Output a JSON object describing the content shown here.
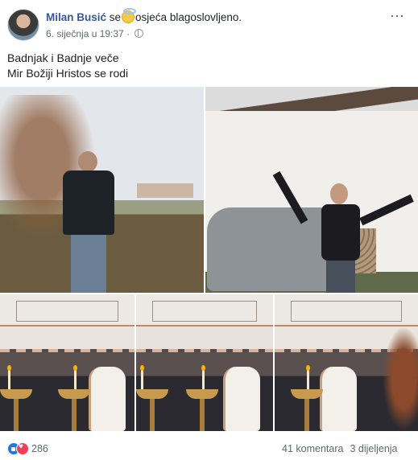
{
  "post": {
    "author": "Milan Busić",
    "feeling_prefix": "se",
    "feeling_text": "osjeća blagoslovljeno.",
    "timestamp": "6. siječnja u 19:37",
    "more_icon": "⋯",
    "text_lines": [
      "Badnjak i Badnje veče",
      "Mir Božiji Hristos se rodi"
    ]
  },
  "photos": [
    {
      "name": "photo-man-with-oak-branches"
    },
    {
      "name": "photo-man-raising-pistol"
    },
    {
      "name": "photo-church-gathering-1"
    },
    {
      "name": "photo-church-gathering-2"
    },
    {
      "name": "photo-church-gathering-3"
    }
  ],
  "footer": {
    "reaction_count": "286",
    "comments": "41 komentara",
    "shares": "3 dijeljenja"
  },
  "colors": {
    "link": "#385898",
    "like": "#1877f2",
    "love": "#f33e58",
    "meta": "#616770"
  },
  "icons": {
    "feeling": "halo-smiley-icon",
    "privacy": "globe-icon",
    "reactions": [
      "like-icon",
      "love-icon"
    ]
  }
}
